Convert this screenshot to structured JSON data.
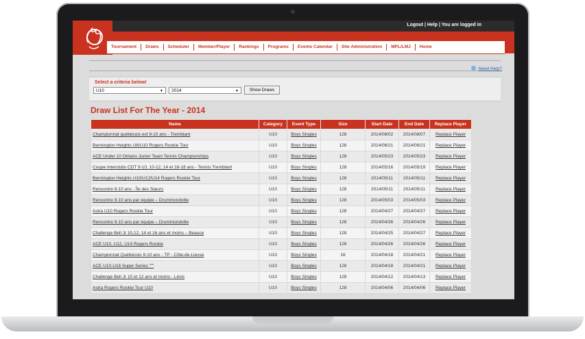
{
  "topbar": {
    "logout": "Logout",
    "help": "Help",
    "logged_in": "You are logged in",
    "separator": " | "
  },
  "nav": [
    "Tournament",
    "Draws",
    "Scheduler",
    "Member/Player",
    "Rankings",
    "Programs",
    "Events Calendar",
    "Site Administration",
    "MPL/LMJ",
    "Home"
  ],
  "help_link": "Need Help?",
  "criteria": {
    "label": "Select a criteria below!",
    "category_value": "U10",
    "year_value": "2014",
    "button": "Show Draws"
  },
  "page_title": "Draw List For The Year - 2014",
  "table": {
    "headers": [
      "Name",
      "Category",
      "Event Type",
      "Size",
      "Start Date",
      "End Date",
      "Replace Player"
    ],
    "rows": [
      [
        "Championnat québécois ext 9-10 ans - Tremblant",
        "U10",
        "Boys Singles",
        "128",
        "2014/08/02",
        "2014/08/07",
        "Replace Player"
      ],
      [
        "Bennington Heights U8/U10 Rogers Rookie Tour",
        "U10",
        "Boys Singles",
        "128",
        "2014/06/21",
        "2014/06/21",
        "Replace Player"
      ],
      [
        "ACE Under 10 Ontario Junior Team Tennis Championships",
        "U10",
        "Boys Singles",
        "128",
        "2014/05/23",
        "2014/05/23",
        "Replace Player"
      ],
      [
        "Coupe Interclubs CDT 9-10, 10-12, 14 et 16-18 ans - Tennis Tremblant",
        "U10",
        "Boys Singles",
        "128",
        "2014/05/16",
        "2014/05/19",
        "Replace Player"
      ],
      [
        "Bennington Heights U10/U12/U14 Rogers Rookie Tour",
        "U10",
        "Boys Singles",
        "128",
        "2014/05/11",
        "2014/05/11",
        "Replace Player"
      ],
      [
        "Rencontre 9-10 ans - Île des Sœurs",
        "U10",
        "Boys Singles",
        "128",
        "2014/05/11",
        "2014/05/11",
        "Replace Player"
      ],
      [
        "Rencontre 9-10 ans par équipe – Drummondville",
        "U10",
        "Boys Singles",
        "128",
        "2014/05/03",
        "2014/05/03",
        "Replace Player"
      ],
      [
        "Astra U10 Rogers Rookie Tour",
        "U10",
        "Boys Singles",
        "128",
        "2014/04/27",
        "2014/04/27",
        "Replace Player"
      ],
      [
        "Rencontre 9-10 ans par équipe – Drummondville",
        "U10",
        "Boys Singles",
        "128",
        "2014/04/26",
        "2014/04/26",
        "Replace Player"
      ],
      [
        "Challenge Bell Jr 10,12, 14 et 16 ans et moins – Beauce",
        "U10",
        "Boys Singles",
        "128",
        "2014/04/25",
        "2014/04/27",
        "Replace Player"
      ],
      [
        "ACE U10, U12, U14 Rogers Rookie",
        "U10",
        "Boys Singles",
        "128",
        "2014/04/26",
        "2014/04/26",
        "Replace Player"
      ],
      [
        "Championnat Québécois 9-10 ans - TP - Côte-de-Liesse",
        "U10",
        "Boys Singles",
        "16",
        "2014/04/18",
        "2014/04/21",
        "Replace Player"
      ],
      [
        "ACE U10-U16 Super Series \"\"\"",
        "U10",
        "Boys Singles",
        "128",
        "2014/04/18",
        "2014/04/21",
        "Replace Player"
      ],
      [
        "Challenge Bell Jr 10 et 12 ans et moins - Lévis",
        "U10",
        "Boys Singles",
        "128",
        "2014/04/12",
        "2014/04/13",
        "Replace Player"
      ],
      [
        "Astra Rogers Rookie Tour U10",
        "U10",
        "Boys Singles",
        "128",
        "2014/04/06",
        "2014/04/06",
        "Replace Player"
      ]
    ]
  }
}
